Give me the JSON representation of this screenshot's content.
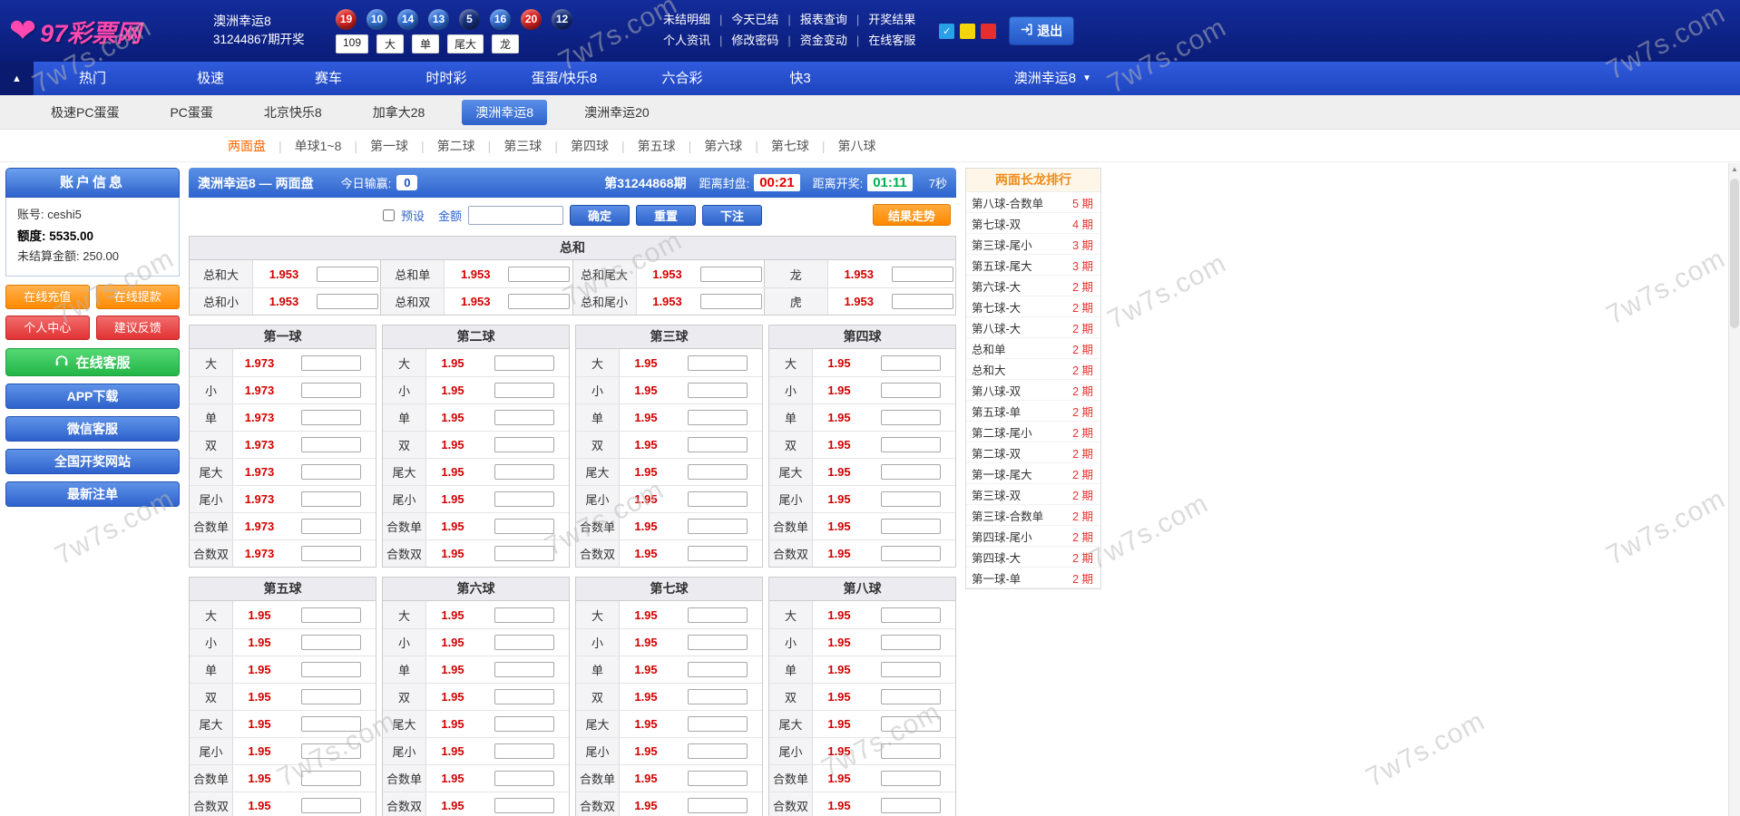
{
  "watermark": "7w7s.com",
  "colors": {
    "header_bg": "#0d2288",
    "nav_bg": "#2853d2",
    "accent_blue": "#2e62cc",
    "accent_orange": "#ff8800",
    "odds_red": "#d40000",
    "countdown_red": "#e60000",
    "countdown_green": "#00b050",
    "tab_active_orange": "#ff6600",
    "logo_pink": "#ff49b0"
  },
  "icons": {
    "collapse": "▲",
    "dropdown": "▼",
    "check": "✓",
    "separator": "|",
    "scroll_up": "▲",
    "heart": "❤"
  },
  "header": {
    "logo": "97彩票网",
    "lottery_name": "澳洲幸运8",
    "issue_text": "31244867期开奖",
    "balls": [
      {
        "n": "19",
        "color": "red"
      },
      {
        "n": "10",
        "color": "blue"
      },
      {
        "n": "14",
        "color": "blue"
      },
      {
        "n": "13",
        "color": "blue"
      },
      {
        "n": "5",
        "color": "navy"
      },
      {
        "n": "16",
        "color": "blue"
      },
      {
        "n": "20",
        "color": "red"
      },
      {
        "n": "12",
        "color": "navy"
      }
    ],
    "result_tags": [
      "109",
      "大",
      "单",
      "尾大",
      "龙"
    ],
    "links_row1": [
      "未结明细",
      "今天已结",
      "报表查询",
      "开奖结果"
    ],
    "links_row2": [
      "个人资讯",
      "修改密码",
      "资金变动",
      "在线客服"
    ],
    "logout": "退出"
  },
  "nav": {
    "items": [
      "热门",
      "极速",
      "赛车",
      "时时彩",
      "蛋蛋/快乐8",
      "六合彩",
      "快3"
    ],
    "current": "澳洲幸运8"
  },
  "subnav": {
    "items": [
      "极速PC蛋蛋",
      "PC蛋蛋",
      "北京快乐8",
      "加拿大28",
      "澳洲幸运8",
      "澳洲幸运20"
    ],
    "active": "澳洲幸运8"
  },
  "tabs": [
    "两面盘",
    "单球1~8",
    "第一球",
    "第二球",
    "第三球",
    "第四球",
    "第五球",
    "第六球",
    "第七球",
    "第八球"
  ],
  "active_tab": "两面盘",
  "sidebar": {
    "account_title": "账户信息",
    "account_label": "账号:",
    "account_value": "ceshi5",
    "balance_label": "额度:",
    "balance_value": "5535.00",
    "unsettled_label": "未结算金额:",
    "unsettled_value": "250.00",
    "btn_recharge": "在线充值",
    "btn_withdraw": "在线提款",
    "btn_personal": "个人中心",
    "btn_feedback": "建议反馈",
    "btn_service": "在线客服",
    "btn_app": "APP下载",
    "btn_wechat": "微信客服",
    "btn_national": "全国开奖网站",
    "btn_orders": "最新注单"
  },
  "panel": {
    "title": "澳洲幸运8 — 两面盘",
    "win_label": "今日输赢:",
    "win_value": "0",
    "issue": "第31244868期",
    "close_label": "距离封盘:",
    "close_value": "00:21",
    "open_label": "距离开奖:",
    "open_value": "01:11",
    "refresh": "7秒",
    "preset": "预设",
    "amount": "金额",
    "confirm": "确定",
    "reset": "重置",
    "bet": "下注",
    "trend": "结果走势"
  },
  "betting": {
    "sum_title": "总和",
    "sum_rows": [
      [
        {
          "label": "总和大",
          "odds": "1.953"
        },
        {
          "label": "总和单",
          "odds": "1.953"
        },
        {
          "label": "总和尾大",
          "odds": "1.953"
        },
        {
          "label": "龙",
          "odds": "1.953"
        }
      ],
      [
        {
          "label": "总和小",
          "odds": "1.953"
        },
        {
          "label": "总和双",
          "odds": "1.953"
        },
        {
          "label": "总和尾小",
          "odds": "1.953"
        },
        {
          "label": "虎",
          "odds": "1.953"
        }
      ]
    ],
    "row_labels": [
      "大",
      "小",
      "单",
      "双",
      "尾大",
      "尾小",
      "合数单",
      "合数双"
    ],
    "ball_sections": [
      {
        "groups": [
          {
            "title": "第一球",
            "odds": [
              "1.973",
              "1.973",
              "1.973",
              "1.973",
              "1.973",
              "1.973",
              "1.973",
              "1.973"
            ]
          },
          {
            "title": "第二球",
            "odds": [
              "1.95",
              "1.95",
              "1.95",
              "1.95",
              "1.95",
              "1.95",
              "1.95",
              "1.95"
            ]
          },
          {
            "title": "第三球",
            "odds": [
              "1.95",
              "1.95",
              "1.95",
              "1.95",
              "1.95",
              "1.95",
              "1.95",
              "1.95"
            ]
          },
          {
            "title": "第四球",
            "odds": [
              "1.95",
              "1.95",
              "1.95",
              "1.95",
              "1.95",
              "1.95",
              "1.95",
              "1.95"
            ]
          }
        ]
      },
      {
        "groups": [
          {
            "title": "第五球",
            "odds": [
              "1.95",
              "1.95",
              "1.95",
              "1.95",
              "1.95",
              "1.95",
              "1.95",
              "1.95"
            ]
          },
          {
            "title": "第六球",
            "odds": [
              "1.95",
              "1.95",
              "1.95",
              "1.95",
              "1.95",
              "1.95",
              "1.95",
              "1.95"
            ]
          },
          {
            "title": "第七球",
            "odds": [
              "1.95",
              "1.95",
              "1.95",
              "1.95",
              "1.95",
              "1.95",
              "1.95",
              "1.95"
            ]
          },
          {
            "title": "第八球",
            "odds": [
              "1.95",
              "1.95",
              "1.95",
              "1.95",
              "1.95",
              "1.95",
              "1.95",
              "1.95"
            ]
          }
        ]
      }
    ]
  },
  "ranking": {
    "title": "两面长龙排行",
    "rows": [
      {
        "name": "第八球-合数单",
        "count": "5 期"
      },
      {
        "name": "第七球-双",
        "count": "4 期"
      },
      {
        "name": "第三球-尾小",
        "count": "3 期"
      },
      {
        "name": "第五球-尾大",
        "count": "3 期"
      },
      {
        "name": "第六球-大",
        "count": "2 期"
      },
      {
        "name": "第七球-大",
        "count": "2 期"
      },
      {
        "name": "第八球-大",
        "count": "2 期"
      },
      {
        "name": "总和单",
        "count": "2 期"
      },
      {
        "name": "总和大",
        "count": "2 期"
      },
      {
        "name": "第八球-双",
        "count": "2 期"
      },
      {
        "name": "第五球-单",
        "count": "2 期"
      },
      {
        "name": "第二球-尾小",
        "count": "2 期"
      },
      {
        "name": "第二球-双",
        "count": "2 期"
      },
      {
        "name": "第一球-尾大",
        "count": "2 期"
      },
      {
        "name": "第三球-双",
        "count": "2 期"
      },
      {
        "name": "第三球-合数单",
        "count": "2 期"
      },
      {
        "name": "第四球-尾小",
        "count": "2 期"
      },
      {
        "name": "第四球-大",
        "count": "2 期"
      },
      {
        "name": "第一球-单",
        "count": "2 期"
      }
    ]
  }
}
